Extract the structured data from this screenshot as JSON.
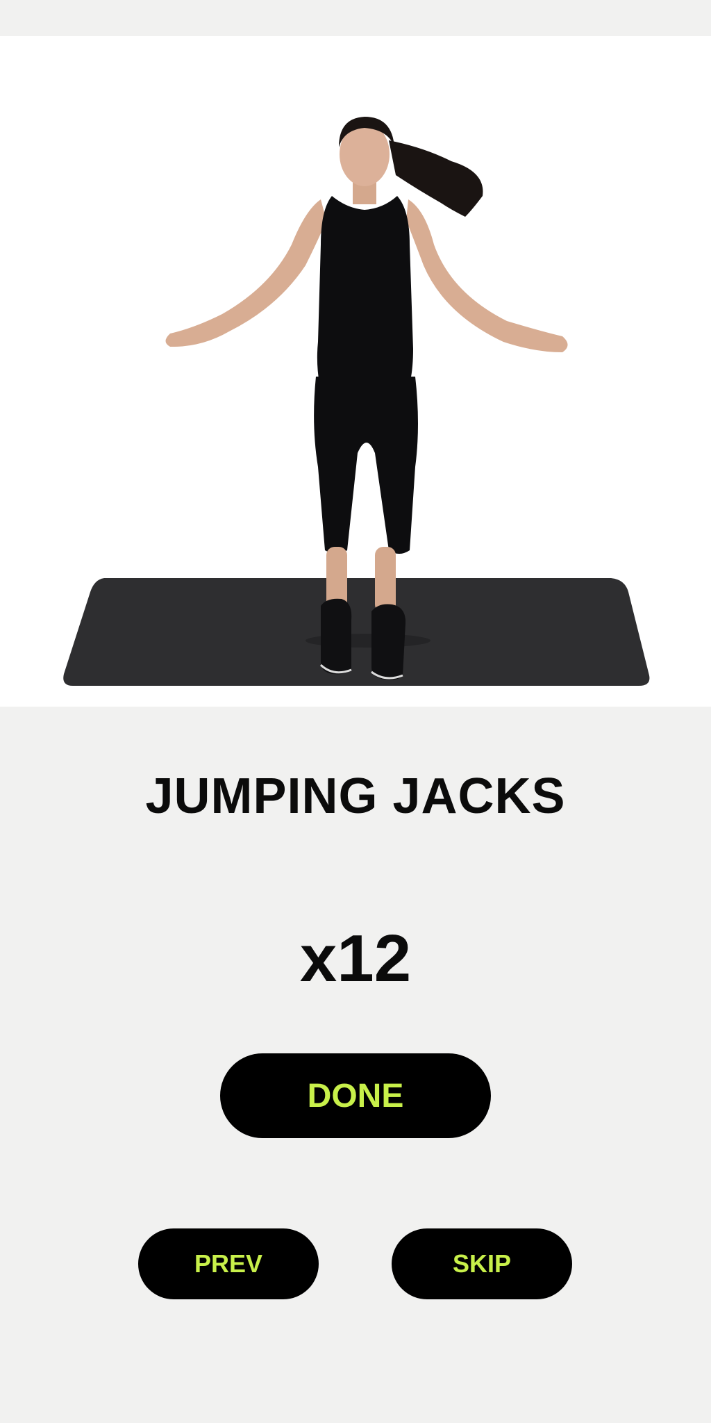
{
  "exercise": {
    "title": "JUMPING JACKS",
    "reps": "x12",
    "image": "exercise-demo-image"
  },
  "actions": {
    "done_label": "DONE",
    "prev_label": "PREV",
    "skip_label": "SKIP"
  },
  "colors": {
    "background": "#f1f1f0",
    "button_bg": "#000000",
    "button_text": "#c8f04a",
    "title_text": "#0b0b0b"
  }
}
